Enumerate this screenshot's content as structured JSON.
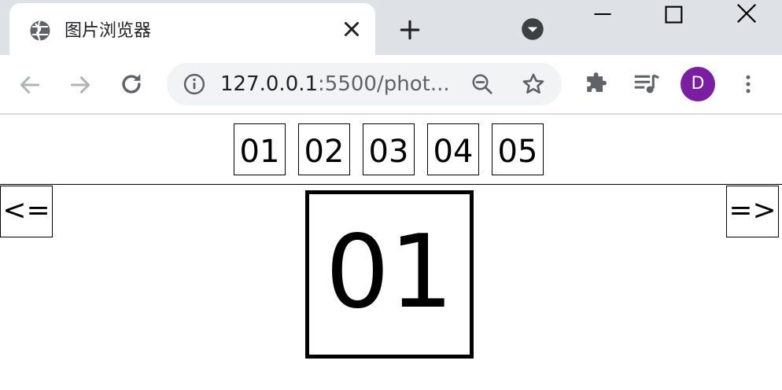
{
  "browser": {
    "tab": {
      "title": "图片浏览器",
      "favicon": "globe-icon"
    },
    "address": {
      "host": "127.0.0.1",
      "rest": ":5500/phot..."
    },
    "profile_initial": "D",
    "colors": {
      "tab_strip": "#dee1e6",
      "omnibox": "#f1f3f4",
      "avatar": "#7b1fa2"
    }
  },
  "page": {
    "thumbnails": [
      "01",
      "02",
      "03",
      "04",
      "05"
    ],
    "prev_label": "<=",
    "next_label": "=>",
    "current_photo": "01"
  }
}
